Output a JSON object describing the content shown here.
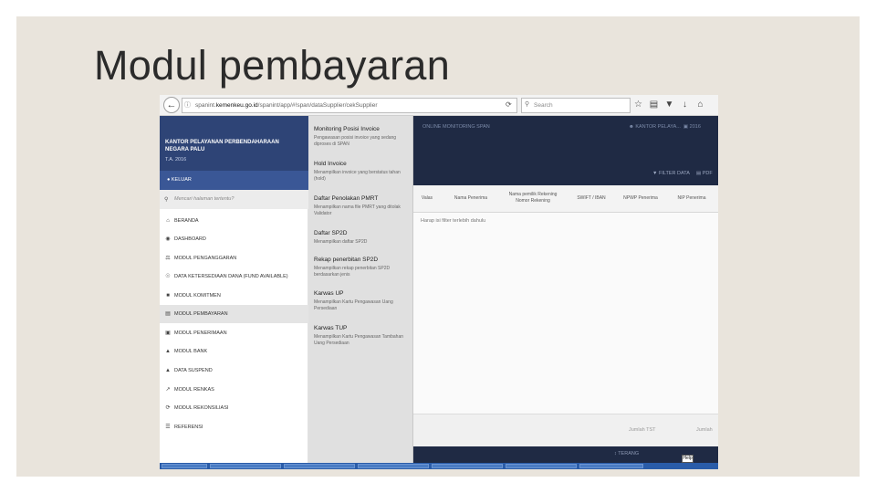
{
  "slide": {
    "title": "Modul pembayaran"
  },
  "browser": {
    "url_prefix": "spanint.",
    "url_domain": "kemenkeu.go.id",
    "url_path": "/spanint/app/#!span/dataSupplier/cekSupplier",
    "search_placeholder": "Search"
  },
  "app": {
    "online_label": "ONLINE MONITORING SPAN",
    "kantor_label": "KANTOR PELAYA...",
    "year_badge": "2016",
    "filter_label": "FILTER DATA",
    "pdf_label": "PDF",
    "columns": [
      "Valas",
      "Nama Penerima",
      "Nama pemilik Rekening Nomor Rekening",
      "SWIFT / IBAN",
      "NPWP Penerima",
      "NIP Penerima"
    ],
    "empty_message": "Harap isi filter terlebih dahulu",
    "footer_col1": "Jumlah TST",
    "footer_col2": "Jumlah",
    "footer_text": "TERANG",
    "help_label": "Help"
  },
  "sidebar": {
    "office": "KANTOR PELAYANAN PERBENDAHARAAN NEGARA PALU",
    "ta": "T.A. 2016",
    "logout": "KELUAR",
    "search_placeholder": "Mencari halaman tertentu?",
    "items": [
      {
        "label": "BERANDA"
      },
      {
        "label": "DASHBOARD"
      },
      {
        "label": "MODUL PENGANGGARAN"
      },
      {
        "label": "DATA KETERSEDIAAN DANA (FUND AVAILABLE)"
      },
      {
        "label": "MODUL KOMITMEN"
      },
      {
        "label": "MODUL PEMBAYARAN"
      },
      {
        "label": "MODUL PENERIMAAN"
      },
      {
        "label": "MODUL BANK"
      },
      {
        "label": "DATA SUSPEND"
      },
      {
        "label": "MODUL RENKAS"
      },
      {
        "label": "MODUL REKONSILIASI"
      },
      {
        "label": "REFERENSI"
      }
    ]
  },
  "panel": {
    "items": [
      {
        "title": "Monitoring Posisi Invoice",
        "desc": "Pengawasan posisi invoice yang sedang diproses di SPAN"
      },
      {
        "title": "Hold Invoice",
        "desc": "Menampilkan invoice yang berstatus tahan (hold)"
      },
      {
        "title": "Daftar Penolakan PMRT",
        "desc": "Menampilkan nama file PMRT yang ditolak Validator"
      },
      {
        "title": "Daftar SP2D",
        "desc": "Menampilkan daftar SP2D"
      },
      {
        "title": "Rekap penerbitan SP2D",
        "desc": "Menampilkan rekap penerbitan SP2D berdasarkan jenis"
      },
      {
        "title": "Karwas UP",
        "desc": "Menampilkan Kartu Pengawasan Uang Persediaan"
      },
      {
        "title": "Karwas TUP",
        "desc": "Menampilkan Kartu Pengawasan Tambahan Uang Persediaan"
      }
    ]
  }
}
